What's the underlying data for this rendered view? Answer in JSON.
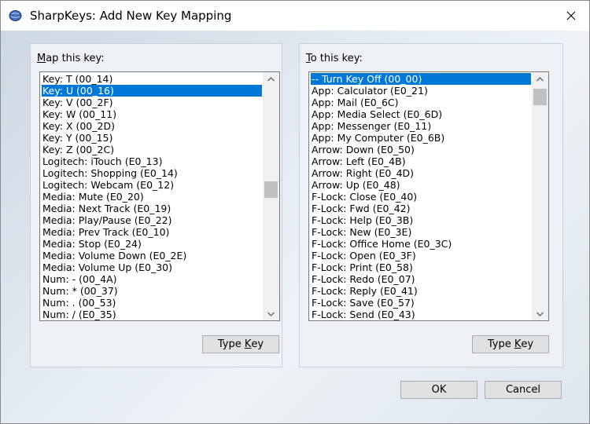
{
  "window": {
    "title": "SharpKeys: Add New Key Mapping"
  },
  "left_panel": {
    "label_accel": "M",
    "label_rest": "ap this key:",
    "items": [
      "Key: T (00_14)",
      "Key: U (00_16)",
      "Key: V (00_2F)",
      "Key: W (00_11)",
      "Key: X (00_2D)",
      "Key: Y (00_15)",
      "Key: Z (00_2C)",
      "Logitech: iTouch (E0_13)",
      "Logitech: Shopping (E0_14)",
      "Logitech: Webcam (E0_12)",
      "Media: Mute (E0_20)",
      "Media: Next Track (E0_19)",
      "Media: Play/Pause (E0_22)",
      "Media: Prev Track (E0_10)",
      "Media: Stop (E0_24)",
      "Media: Volume Down (E0_2E)",
      "Media: Volume Up (E0_30)",
      "Num: - (00_4A)",
      "Num: * (00_37)",
      "Num: . (00_53)",
      "Num: / (E0_35)"
    ],
    "selected_index": 1,
    "type_key_label_pre": "Type ",
    "type_key_label_accel": "K",
    "type_key_label_post": "ey"
  },
  "right_panel": {
    "label_accel": "T",
    "label_rest": "o this key:",
    "items": [
      "-- Turn Key Off (00_00)",
      "App: Calculator (E0_21)",
      "App: Mail (E0_6C)",
      "App: Media Select (E0_6D)",
      "App: Messenger (E0_11)",
      "App: My Computer (E0_6B)",
      "Arrow: Down (E0_50)",
      "Arrow: Left (E0_4B)",
      "Arrow: Right (E0_4D)",
      "Arrow: Up (E0_48)",
      "F-Lock: Close (E0_40)",
      "F-Lock: Fwd (E0_42)",
      "F-Lock: Help (E0_3B)",
      "F-Lock: New (E0_3E)",
      "F-Lock: Office Home (E0_3C)",
      "F-Lock: Open (E0_3F)",
      "F-Lock: Print (E0_58)",
      "F-Lock: Redo (E0_07)",
      "F-Lock: Reply (E0_41)",
      "F-Lock: Save (E0_57)",
      "F-Lock: Send (E0_43)"
    ],
    "selected_index": 0,
    "type_key_label_pre": "Type ",
    "type_key_label_accel": "K",
    "type_key_label_post": "ey"
  },
  "footer": {
    "ok_label": "OK",
    "cancel_label": "Cancel"
  },
  "colors": {
    "selection": "#0078d7",
    "scroll_thumb": "#c1c1c1"
  },
  "icons": {
    "app": "keyboard-globe-icon",
    "close": "close-icon",
    "up": "chevron-up-icon",
    "down": "chevron-down-icon"
  }
}
